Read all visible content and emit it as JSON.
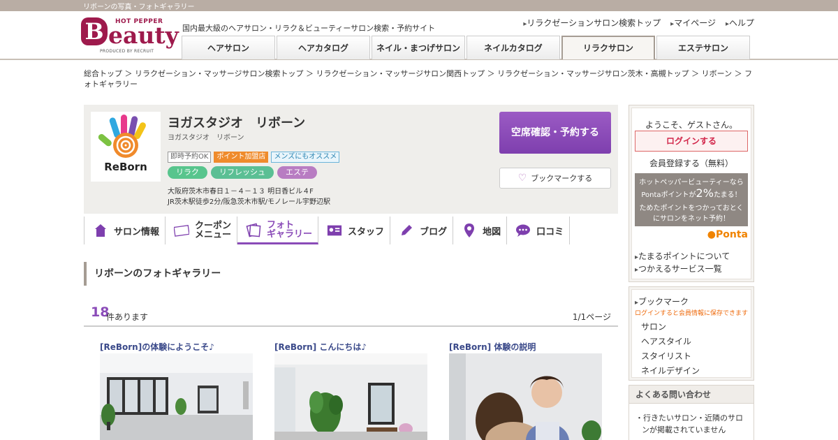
{
  "topbar": {
    "text": "リボーンの写真・フォトギャラリー"
  },
  "header": {
    "logo_top": "HOT PEPPER",
    "logo_letter": "B",
    "logo_rest": "eauty",
    "logo_produced": "PRODUCED BY RECRUIT",
    "tagline": "国内最大級のヘアサロン・リラク＆ビューティーサロン検索・予約サイト",
    "links": [
      "リラクゼーションサロン検索トップ",
      "マイページ",
      "ヘルプ"
    ],
    "nav": [
      {
        "label": "ヘアサロン",
        "active": false
      },
      {
        "label": "ヘアカタログ",
        "active": false
      },
      {
        "label": "ネイル・まつげサロン",
        "active": false
      },
      {
        "label": "ネイルカタログ",
        "active": false
      },
      {
        "label": "リラクサロン",
        "active": true
      },
      {
        "label": "エステサロン",
        "active": false
      }
    ]
  },
  "breadcrumb": "総合トップ ＞ リラクゼーション・マッサージサロン検索トップ ＞ リラクゼーション・マッサージサロン関西トップ ＞ リラクゼーション・マッサージサロン茨木・高槻トップ ＞ リボーン ＞ フォトギャラリー",
  "salon": {
    "logo_text": "ReBorn",
    "name": "ヨガスタジオ　リボーン",
    "kana": "ヨガスタジオ　リボーン",
    "badges": [
      "即時予約OK",
      "ポイント加盟店",
      "メンズにもオススメ"
    ],
    "categories": [
      "リラク",
      "リフレッシュ",
      "エステ"
    ],
    "address": "大阪府茨木市春日１－４－１３ 明日香ビル４F",
    "access": "JR茨木駅徒歩2分/阪急茨木市駅/モノレール宇野辺駅",
    "reserve_label": "空席確認・予約する",
    "bookmark_label": "ブックマークする"
  },
  "tabs": {
    "salon_info": "サロン情報",
    "coupon_l1": "クーポン",
    "coupon_l2": "メニュー",
    "photo_l1": "フォト",
    "photo_l2": "ギャラリー",
    "staff": "スタッフ",
    "blog": "ブログ",
    "map": "地図",
    "review": "口コミ"
  },
  "gallery": {
    "title": "リボーンのフォトギャラリー",
    "count": "18",
    "count_unit": "件あります",
    "page": "1/1ページ",
    "photos": [
      {
        "caption": "[ReBorn]の体験にようこそ♪"
      },
      {
        "caption": "[ReBorn] こんにちは♪"
      },
      {
        "caption": "[ReBorn] 体験の説明"
      }
    ]
  },
  "sidebar": {
    "welcome": "ようこそ、ゲストさん。",
    "login": "ログインする",
    "register": "会員登録する（無料）",
    "ponta_l1": "ホットペッパービューティーなら",
    "ponta_l2a": "Pontaポイントが",
    "ponta_pct": "2%",
    "ponta_l2b": "たまる！",
    "ponta_l3": "ためたポイントをつかっておとく",
    "ponta_l4": "にサロンをネット予約！",
    "ponta_logo": "Ponta",
    "links": [
      "たまるポイントについて",
      "つかえるサービス一覧"
    ],
    "bookmark_title": "ブックマーク",
    "bookmark_note": "ログインすると会員情報に保存できます",
    "bookmark_items": [
      "サロン",
      "ヘアスタイル",
      "スタイリスト",
      "ネイルデザイン"
    ],
    "faq_title": "よくある問い合わせ",
    "faq_q1": "・行きたいサロン・近隣のサロンが掲載されていません"
  }
}
